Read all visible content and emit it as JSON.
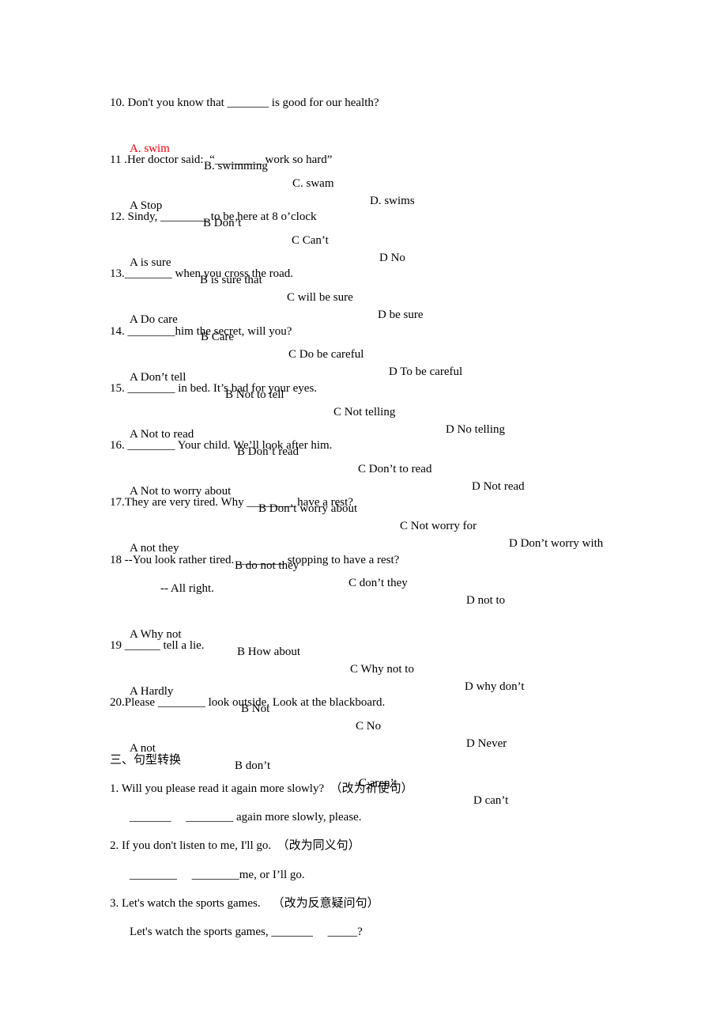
{
  "document": {
    "accent_colors": {
      "answer_highlight": "#ff0000",
      "text": "#000000"
    },
    "questions": [
      {
        "number": "10",
        "stem": "10. Don't you know that _______ is good for our health?",
        "options": [
          "A. swim",
          "B. swimming",
          "C. swam",
          "D. swims"
        ],
        "highlighted_option": 0
      },
      {
        "number": "11",
        "stem": "11 .Her doctor said:  “________ work so hard”",
        "options": [
          "A Stop",
          "B Don’t",
          "C Can’t",
          "D No"
        ]
      },
      {
        "number": "12",
        "stem": "12. Sindy, ________ to be here at 8 o’clock",
        "options": [
          "A is sure",
          "B is sure that",
          "C will be sure",
          "D be sure"
        ]
      },
      {
        "number": "13",
        "stem": "13.________ when you cross the road.",
        "options": [
          "A Do care",
          "B Care",
          "C Do be careful",
          "D To be careful"
        ]
      },
      {
        "number": "14",
        "stem": "14. ________him the secret, will you?",
        "options": [
          "A Don’t tell",
          "B Not to tell",
          "C Not telling",
          "D No telling"
        ]
      },
      {
        "number": "15",
        "stem": "15. ________ in bed. It’s bad for your eyes.",
        "options": [
          "A Not to read",
          "B Don’t read",
          "C Don’t to read",
          "D Not read"
        ]
      },
      {
        "number": "16",
        "stem": "16. ________ Your child. We’ll look after him.",
        "options": [
          "A Not to worry about",
          "B Don’t worry about",
          "C Not worry for",
          "D Don’t worry with"
        ]
      },
      {
        "number": "17",
        "stem": "17.They are very tired. Why ________ have a rest?",
        "options": [
          "A not they",
          "B do not they",
          "C don’t they",
          "D not to"
        ]
      },
      {
        "number": "18",
        "stem": "18 --You look rather tired. ________ stopping to have a rest?",
        "reply": "-- All right.",
        "options": [
          "A Why not",
          "B How about",
          "C Why not to",
          "D why don’t"
        ]
      },
      {
        "number": "19",
        "stem": "19 ______ tell a lie.",
        "options": [
          "A Hardly",
          "B Not",
          "C No",
          "D Never"
        ]
      },
      {
        "number": "20",
        "stem": "20.Please ________ look outside. Look at the blackboard.",
        "options": [
          "A not",
          "B don’t",
          "C aren’t",
          "D can’t"
        ]
      }
    ],
    "section_title": "三、句型转换",
    "transformations": [
      {
        "prompt": "1. Will you please read it again more slowly?  （改为祈使句）",
        "answer_line": "_______     ________ again more slowly, please."
      },
      {
        "prompt": "2. If you don't listen to me, I'll go.  （改为同义句）",
        "answer_line": "________     ________me, or I’ll go."
      },
      {
        "prompt": "3. Let's watch the sports games.    （改为反意疑问句）",
        "answer_line": "Let's watch the sports games, _______     _____?"
      }
    ]
  }
}
